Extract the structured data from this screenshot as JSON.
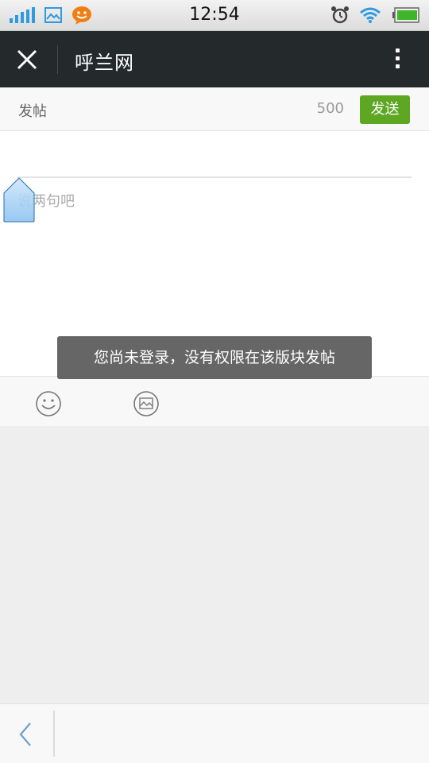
{
  "status_bar": {
    "time": "12:54",
    "left_icons": [
      "signal-icon",
      "image-icon",
      "chat-bubble-icon"
    ],
    "right_icons": [
      "alarm-clock-icon",
      "wifi-icon",
      "battery-icon"
    ]
  },
  "title_bar": {
    "title": "呼兰网",
    "close_icon": "close-icon",
    "menu_icon": "more-vertical-icon"
  },
  "post_bar": {
    "title": "发帖",
    "char_count": "500",
    "send_label": "发送"
  },
  "editor": {
    "subject_value": "",
    "content_placeholder": "说两句吧"
  },
  "toast": {
    "message": "您尚未登录，没有权限在该版块发帖"
  },
  "toolbar": {
    "items": [
      "emoji-icon",
      "image-picker-icon"
    ]
  },
  "bottom_bar": {
    "back_icon": "chevron-left-icon"
  },
  "colors": {
    "title_bar_bg": "#24292c",
    "send_button_bg": "#5ea722",
    "toast_bg": "#5a5a5a",
    "content_area_bg": "#eeeeee",
    "icon_blue": "#2f9ae0"
  }
}
